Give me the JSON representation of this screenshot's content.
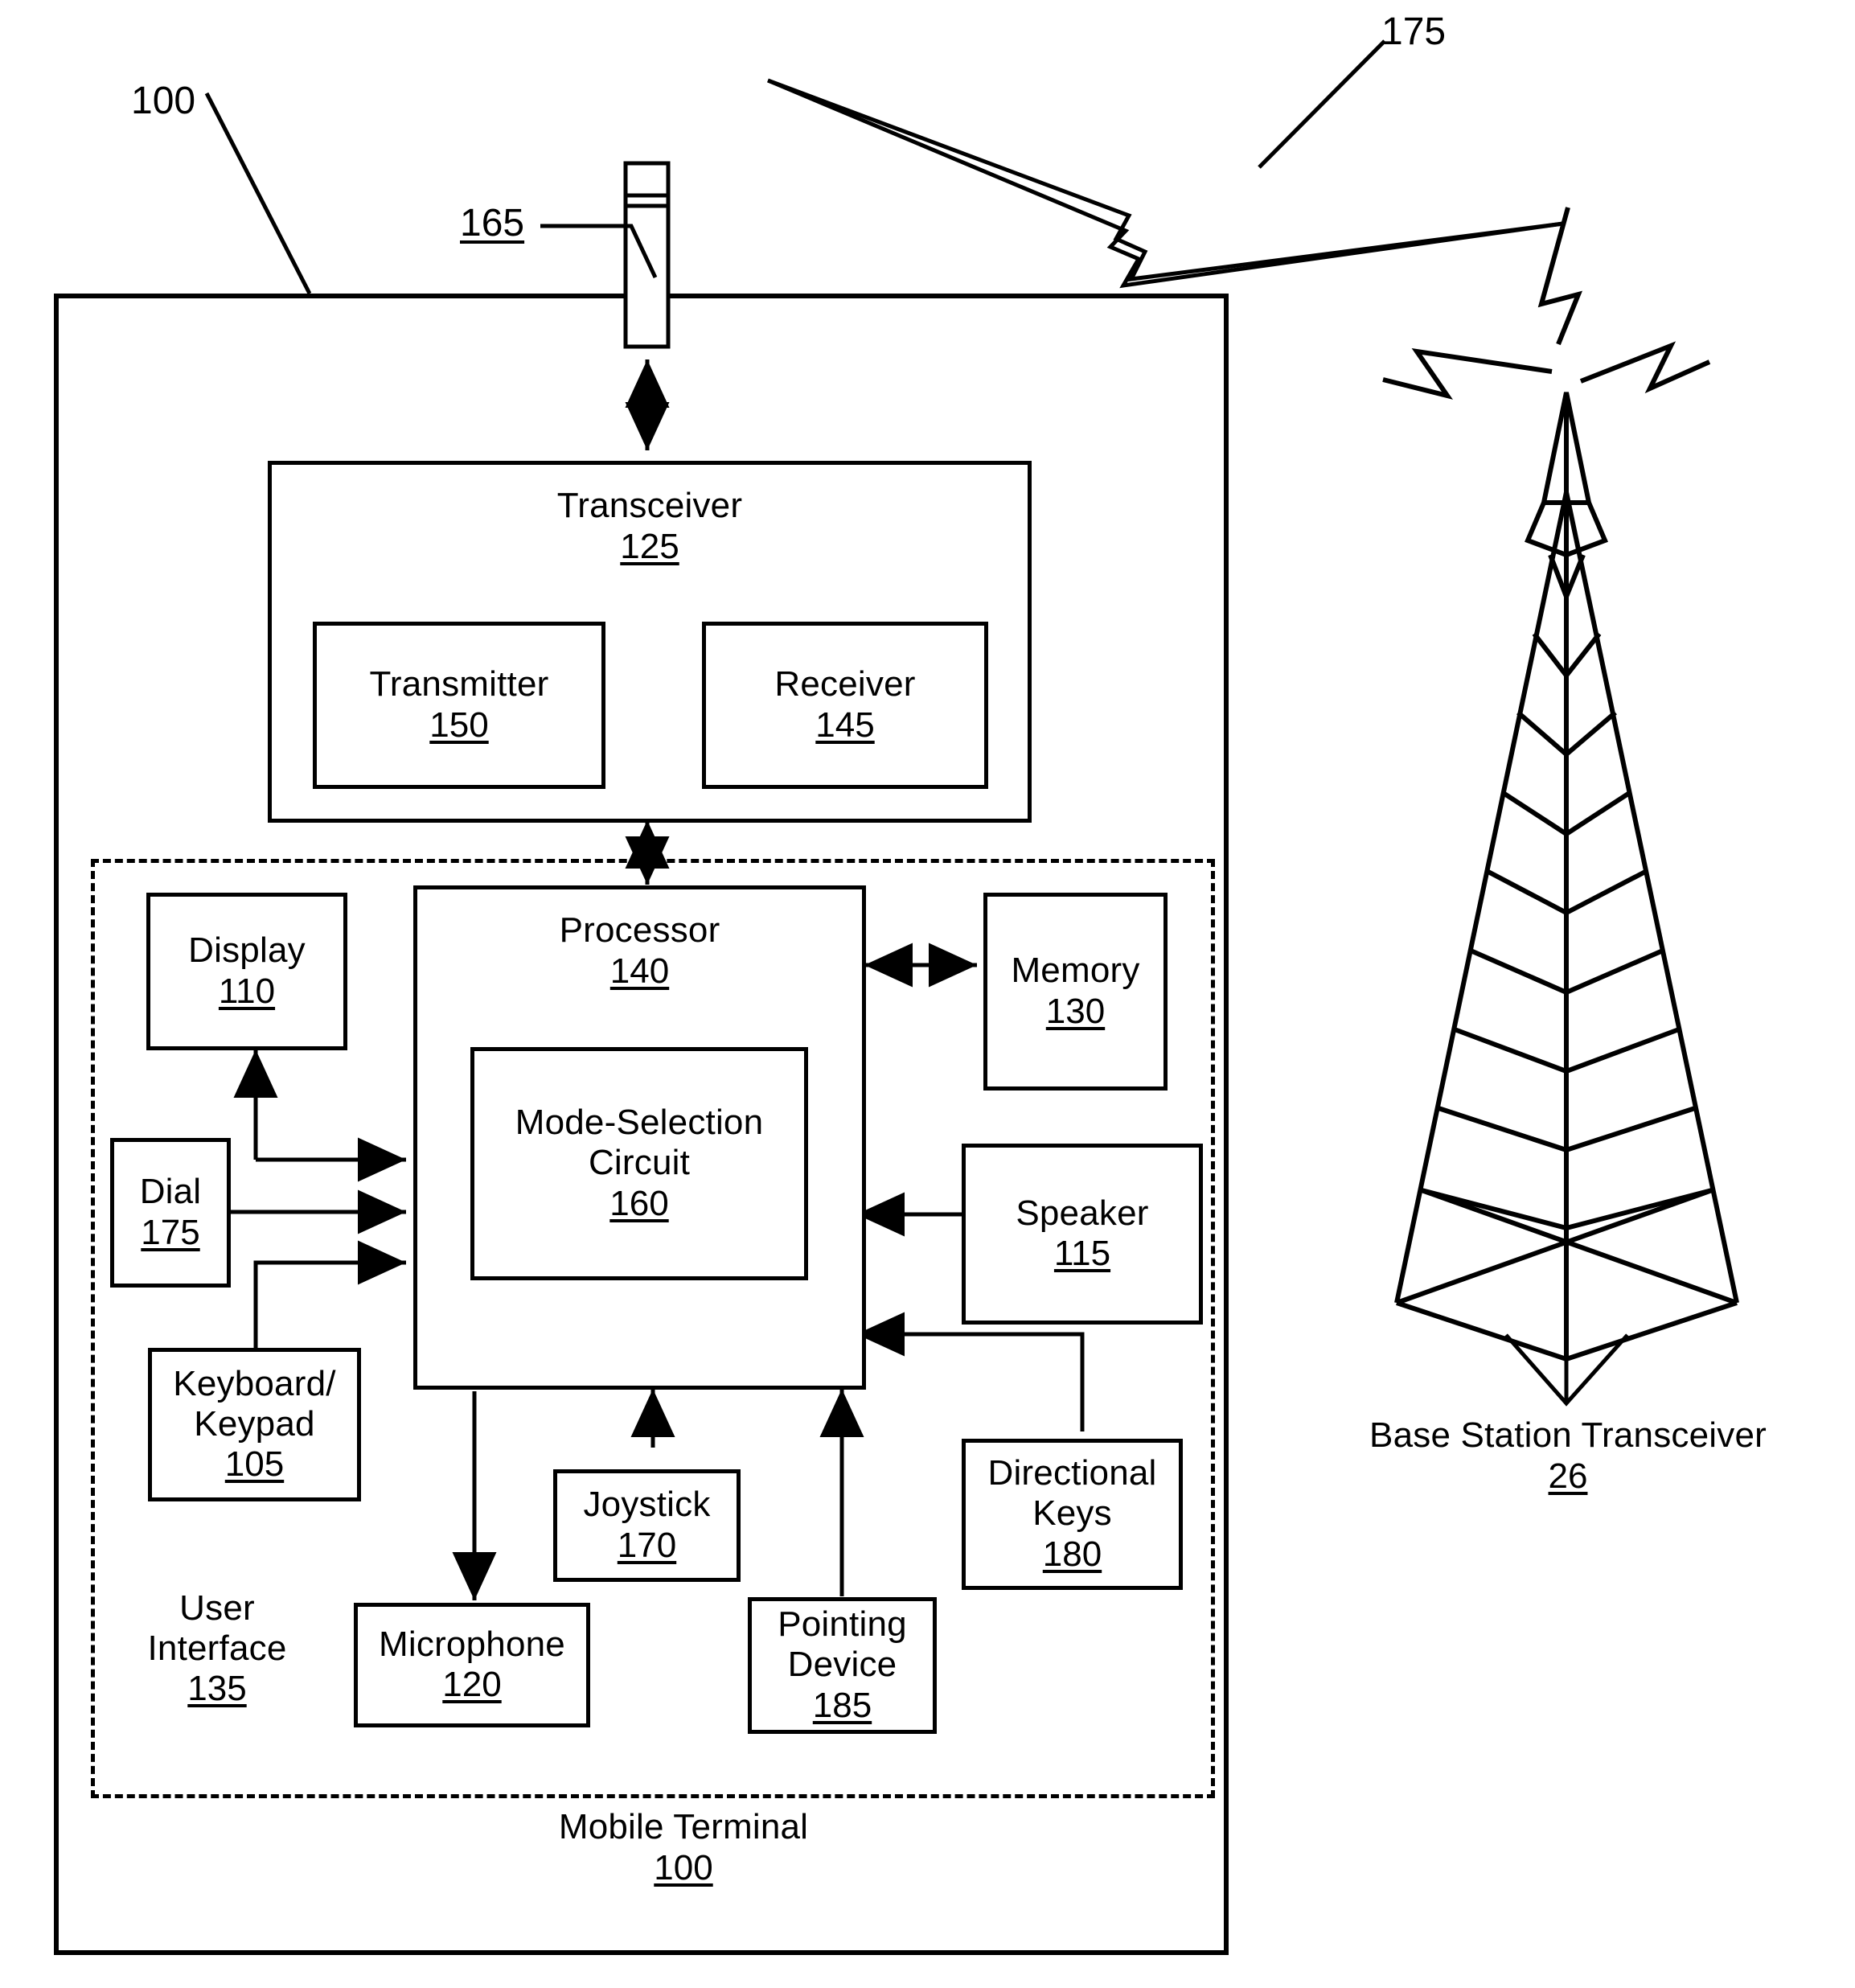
{
  "figure": {
    "type": "patent-block-diagram",
    "outer_ref": "100",
    "antenna_ref": "165",
    "rf_link_ref": "175"
  },
  "blocks": {
    "transceiver": {
      "label": "Transceiver",
      "number": "125"
    },
    "transmitter": {
      "label": "Transmitter",
      "number": "150"
    },
    "receiver": {
      "label": "Receiver",
      "number": "145"
    },
    "processor": {
      "label": "Processor",
      "number": "140"
    },
    "mode_selection": {
      "label": "Mode-Selection\nCircuit",
      "number": "160"
    },
    "memory": {
      "label": "Memory",
      "number": "130"
    },
    "speaker": {
      "label": "Speaker",
      "number": "115"
    },
    "display": {
      "label": "Display",
      "number": "110"
    },
    "dial": {
      "label": "Dial",
      "number": "175"
    },
    "keyboard": {
      "label": "Keyboard/\nKeypad",
      "number": "105"
    },
    "joystick": {
      "label": "Joystick",
      "number": "170"
    },
    "microphone": {
      "label": "Microphone",
      "number": "120"
    },
    "pointing_device": {
      "label": "Pointing\nDevice",
      "number": "185"
    },
    "directional_keys": {
      "label": "Directional\nKeys",
      "number": "180"
    }
  },
  "regions": {
    "user_interface": {
      "label": "User\nInterface",
      "number": "135"
    },
    "mobile_terminal": {
      "label": "Mobile Terminal",
      "number": "100"
    }
  },
  "base_station": {
    "label": "Base Station Transceiver",
    "number": "26"
  },
  "callouts": {
    "terminal_100": "100",
    "antenna_165": "165",
    "link_175": "175"
  },
  "colors": {
    "ink": "#000000",
    "paper": "#ffffff"
  }
}
